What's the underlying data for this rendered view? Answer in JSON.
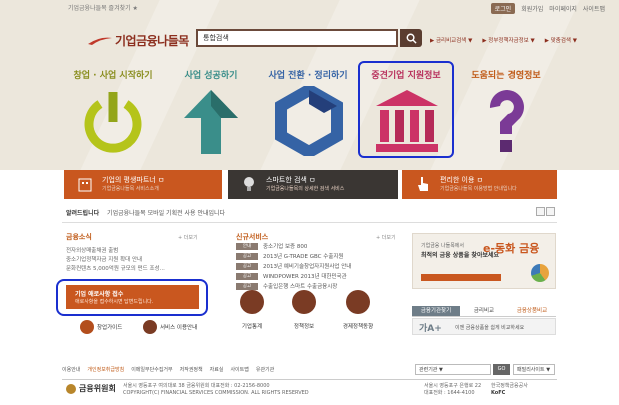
{
  "header": {
    "bookmark": "기업금융나들목 즐겨찾기 ★",
    "util": [
      "로그인",
      "회원가입",
      "마이페이지",
      "사이트맵"
    ],
    "logo_text": "기업금융나들목",
    "search_value": "통합검색",
    "quick_links": [
      "▶ 금리비교검색 ▼",
      "▶ 정부정책자금정보 ▼",
      "▶ 맞춤검색 ▼"
    ]
  },
  "categories": [
    {
      "label": "창업 · 사업 시작하기",
      "color": "#b5c41a"
    },
    {
      "label": "사업 성공하기",
      "color": "#3a8e8a"
    },
    {
      "label": "사업 전환 · 정리하기",
      "color": "#3563a5"
    },
    {
      "label": "중견기업 지원정보",
      "color": "#cc3366"
    },
    {
      "label": "도움되는 경영정보",
      "color": "#7b3a96"
    }
  ],
  "feature_bars": [
    {
      "title": "기업의 평생파트너 ㅁ",
      "sub": "기업금융나들목 서비스소개"
    },
    {
      "title": "스마트한 검색 ㅁ",
      "sub": "기업금융나들목의 상세한 검색 서비스"
    },
    {
      "title": "편리한 이용 ㅁ",
      "sub": "기업금융나들목 이용방법 안내입니다"
    }
  ],
  "notice": {
    "label": "알려드립니다",
    "text": "기업금융나들목 모바일 기획전 사용 안내입니다"
  },
  "finance_news": {
    "title": "금융소식",
    "more": "+ 더보기",
    "items": [
      "전자외상매출채권 출범",
      "중소기업정책자금 지원 확대 안내",
      "문화컨텐츠 5,000억원 규모의 펀드 조성..."
    ]
  },
  "publication": {
    "title": "기업 애로사항 접수",
    "sub": "애로사항을 접수하시면 답변드립니다."
  },
  "guides": [
    "창업가이드",
    "서비스 이용안내"
  ],
  "new_services": {
    "title": "신규서비스",
    "more": "+ 더보기",
    "items": [
      {
        "tag": "안내",
        "text": "중소기업 보증 800"
      },
      {
        "tag": "공고",
        "text": "2013년 G-TRADE GBC 수출지원"
      },
      {
        "tag": "공고",
        "text": "2013년 예비기술창업자지원사업 안내"
      },
      {
        "tag": "공고",
        "text": "WINDPOWER 2013년 대한민국관"
      },
      {
        "tag": "공고",
        "text": "수출입은행 스마트 수출금융시장"
      }
    ]
  },
  "circle_links": [
    "기업통계",
    "정책정보",
    "경제정책동향"
  ],
  "banner": {
    "line1": "기업금융 나들목에서",
    "line2": "최적의 금융 상품을 찾아보세요",
    "brand": "e-동화 금융"
  },
  "tabs": [
    "금융기관찾기",
    "금리비교",
    "금융상품비교"
  ],
  "ga": {
    "big": "가A+",
    "text": "이젠 금융상품을 쉽게 비교하세요"
  },
  "footer": {
    "links": [
      "이용안내",
      "개인정보취급방침",
      "이메일무단수집거부",
      "저작권정책",
      "자료실",
      "사이트맵",
      "유관기관"
    ],
    "family_site": "관련기관 ▼",
    "go": "GO",
    "family2": "패밀리사이트 ▼",
    "org": "금융위원회",
    "addr1": "서울시 영등포구 여의대로 38 금융위원회 대표전화 : 02-2156-8000",
    "addr2": "COPYRIGHT(C) FINANCIAL SERVICES COMMISSION. ALL RIGHTS RESERVED",
    "addr3": "서울시 영등포구 은행로 22",
    "addr4": "대표전화 : 1644-4100",
    "kfb": "한국정책금융공사",
    "kfb2": "KoFC"
  }
}
